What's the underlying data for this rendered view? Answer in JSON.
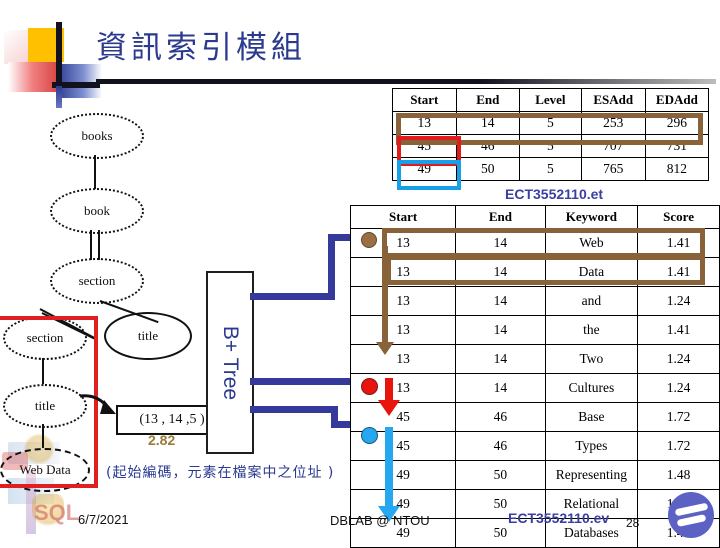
{
  "slide": {
    "title": "資訊索引模組",
    "date": "6/7/2021",
    "org": "DBLAB @ NTOU",
    "page_number": "28"
  },
  "tree": {
    "nodes": [
      {
        "label": "books"
      },
      {
        "label": "book"
      },
      {
        "label": "section"
      },
      {
        "label": "section"
      },
      {
        "label": "title"
      },
      {
        "label": "title"
      },
      {
        "label": "Web Data"
      }
    ],
    "code_box": "(13 , 14 ,5 )",
    "code_value": "2.82",
    "note": "(起始編碼，元素在檔案中之位址 )",
    "btree_label": "B+ Tree"
  },
  "table_top": {
    "headers": [
      "Start",
      "End",
      "Level",
      "ESAdd",
      "EDAdd"
    ],
    "rows": [
      [
        "13",
        "14",
        "5",
        "253",
        "296"
      ],
      [
        "45",
        "46",
        "5",
        "707",
        "731"
      ],
      [
        "49",
        "50",
        "5",
        "765",
        "812"
      ]
    ]
  },
  "table_bottom": {
    "filename": "ECT3552110.et",
    "headers": [
      "Start",
      "End",
      "Keyword",
      "Score"
    ],
    "rows": [
      [
        "13",
        "14",
        "Web",
        "1.41"
      ],
      [
        "13",
        "14",
        "Data",
        "1.41"
      ],
      [
        "13",
        "14",
        "and",
        "1.24"
      ],
      [
        "13",
        "14",
        "the",
        "1.41"
      ],
      [
        "13",
        "14",
        "Two",
        "1.24"
      ],
      [
        "13",
        "14",
        "Cultures",
        "1.24"
      ],
      [
        "45",
        "46",
        "Base",
        "1.72"
      ],
      [
        "45",
        "46",
        "Types",
        "1.72"
      ],
      [
        "49",
        "50",
        "Representing",
        "1.48"
      ],
      [
        "49",
        "50",
        "Relational",
        "1.48"
      ],
      [
        "49",
        "50",
        "Databases",
        "1.48"
      ]
    ]
  },
  "footer_filename": "ECT3552110.ev",
  "colors": {
    "title": "#2b3a8f",
    "brown": "#8a6239",
    "red": "#e8150f",
    "blue": "#25a8ef",
    "navy": "#34399b"
  }
}
